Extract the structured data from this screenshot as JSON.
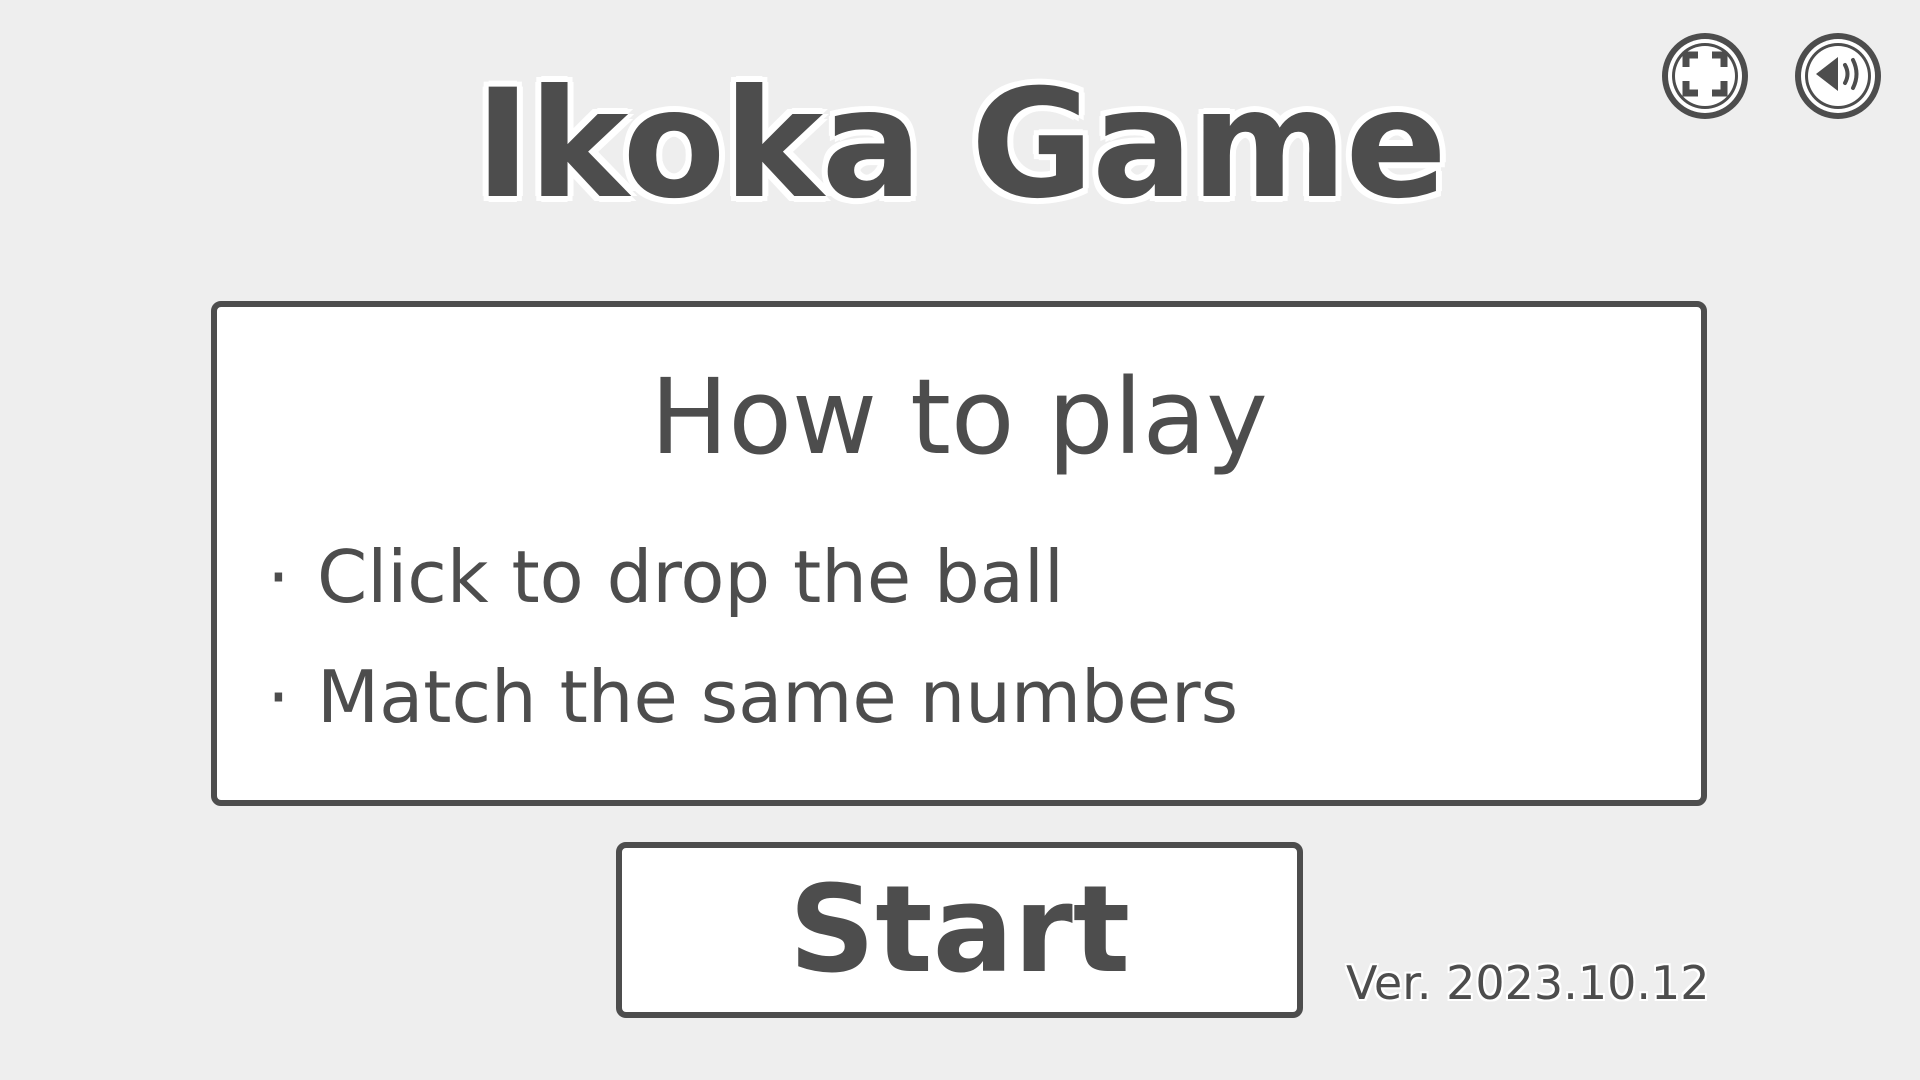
{
  "title": "Ikoka Game",
  "icons": {
    "fullscreen": "fullscreen-icon",
    "sound": "sound-icon"
  },
  "how_to_play": {
    "heading": "How to play",
    "bullet": "·",
    "items": [
      "Click to drop the ball",
      "Match the same numbers"
    ]
  },
  "start_label": "Start",
  "version": "Ver. 2023.10.12",
  "colors": {
    "background": "#eeeeee",
    "ink": "#4d4d4d",
    "panel": "#ffffff"
  }
}
